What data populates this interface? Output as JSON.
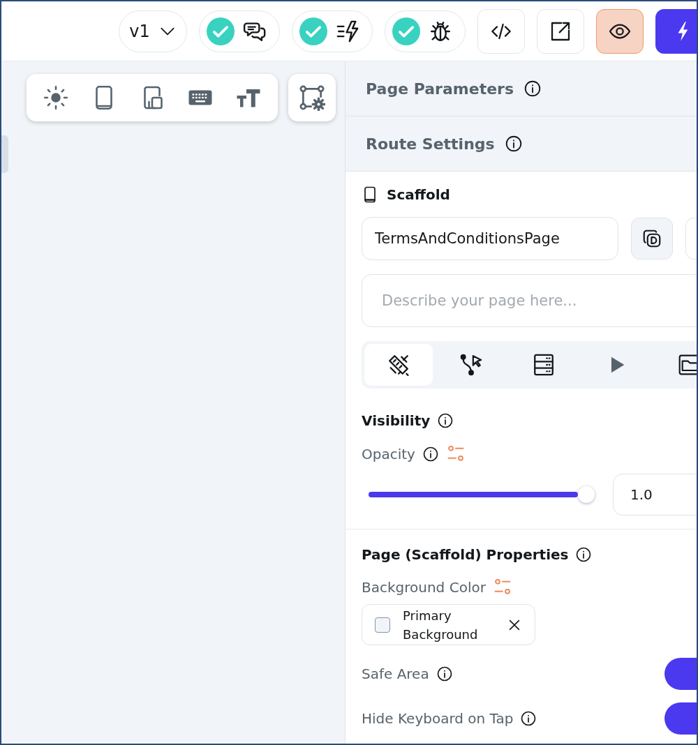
{
  "toolbar": {
    "version": "v1",
    "checks": [
      {
        "kind": "chat",
        "passed": true
      },
      {
        "kind": "actions",
        "passed": true
      },
      {
        "kind": "debug",
        "passed": true
      }
    ],
    "actions": [
      {
        "kind": "code",
        "active": false
      },
      {
        "kind": "export",
        "active": false
      },
      {
        "kind": "preview",
        "active": true
      },
      {
        "kind": "run",
        "active": false
      }
    ]
  },
  "canvas": {
    "tools": [
      {
        "kind": "theme"
      },
      {
        "kind": "phone"
      },
      {
        "kind": "devices"
      },
      {
        "kind": "keyboard"
      },
      {
        "kind": "text-size"
      }
    ],
    "side_tool": {
      "kind": "layout-settings"
    }
  },
  "panel": {
    "sections": [
      {
        "title": "Page Parameters"
      },
      {
        "title": "Route Settings"
      }
    ],
    "widget": {
      "title": "Scaffold",
      "name": "TermsAndConditionsPage",
      "placeholder": "Describe your page here..."
    },
    "tabs": [
      {
        "kind": "properties",
        "selected": true
      },
      {
        "kind": "actions",
        "selected": false
      },
      {
        "kind": "backend",
        "selected": false
      },
      {
        "kind": "preview",
        "selected": false
      },
      {
        "kind": "files",
        "selected": false
      }
    ],
    "visibility": {
      "title": "Visibility",
      "opacity_label": "Opacity",
      "level": 1.0,
      "value": "1.0"
    },
    "properties": {
      "title": "Page (Scaffold) Properties",
      "background_label": "Background Color",
      "background_value": "Primary Background",
      "switches": [
        {
          "label": "Safe Area",
          "on": true
        },
        {
          "label": "Hide Keyboard on Tap",
          "on": true
        }
      ]
    }
  }
}
